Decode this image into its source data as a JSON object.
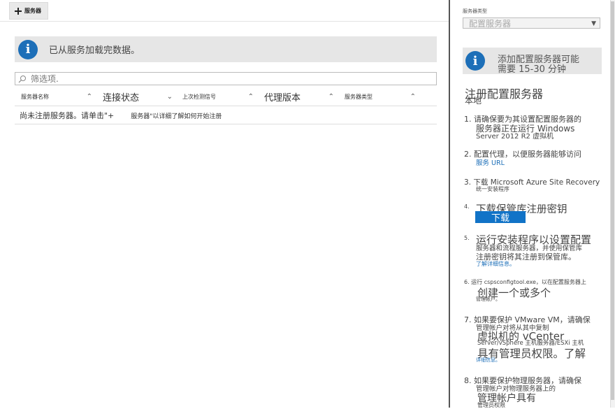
{
  "toolbar": {
    "add_server_label": "服务器"
  },
  "info_banner": {
    "message": "已从服务加载完数据。"
  },
  "filter": {
    "placeholder": "筛选项."
  },
  "table": {
    "columns": [
      "服务器名称",
      "连接状态",
      "上次检测信号",
      "代理版本",
      "服务器类型"
    ],
    "empty_message_part1": "尚未注册服务器。请单击\"+",
    "empty_message_part2": "服务器\"以详细了解如何开始注册"
  },
  "right_panel": {
    "server_type_label": "服务器类型",
    "server_type_value": "配置服务器",
    "notice_line1": "添加配置服务器可能",
    "notice_line2": "需要 15-30 分钟",
    "title": "注册配置服务器",
    "subtitle": "本地",
    "steps": {
      "s1_line1": "1. 请确保要为其设置配置服务器的",
      "s1_line2": "服务器正在运行 Windows",
      "s1_line3": "Server 2012 R2 虚拟机",
      "s2_line1": "2. 配置代理，以便服务器能够访问",
      "s2_link": "服务 URL",
      "s3_line1": "3. 下载 Microsoft Azure Site Recovery",
      "s3_line2": "统一安装程序",
      "s4_num": "4.",
      "s4_line1": "下载保管库注册密钥",
      "s4_button": "下载",
      "s5_num": "5.",
      "s5_line1": "运行安装程序以设置配置",
      "s5_line2": "服务器和流程服务器，并使用保管库",
      "s5_line3": "注册密钥将其注册到保管库。",
      "s5_link": "了解详细信息。",
      "s6_line1": "6. 运行 cspsconfigtool.exe，以在配置服务器上",
      "s6_line2": "创建一个或多个",
      "s6_line3": "管理帐户。",
      "s7_line1": "7. 如果要保护 VMware VM，请确保",
      "s7_line2": "管理帐户对将从其中复制",
      "s7_line3": "虚拟机的 vCenter",
      "s7_line4": "Server/vSphere 主机服务器/ESXi 主机",
      "s7_line5": "具有管理员权限。了解",
      "s7_link": "详细信息。",
      "s8_line1": "8. 如果要保护物理服务器，请确保",
      "s8_line2": "管理帐户对物理服务器上的",
      "s8_line3": "管理帐户具有",
      "s8_line4": "管理员权限"
    }
  }
}
